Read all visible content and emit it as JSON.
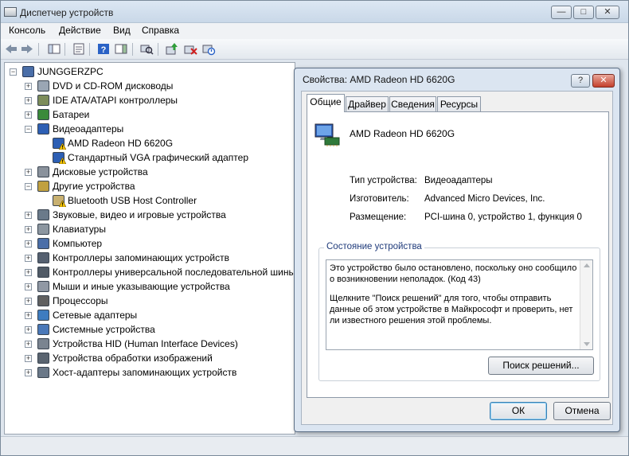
{
  "window": {
    "title": "Диспетчер устройств",
    "caption": {
      "minimize": "—",
      "maximize": "□",
      "close": "✕"
    }
  },
  "menu": [
    "Консоль",
    "Действие",
    "Вид",
    "Справка"
  ],
  "tree": {
    "root": "JUNGGERZPC",
    "items": [
      {
        "label": "DVD и CD-ROM дисководы",
        "icon": "dvd-drive-icon"
      },
      {
        "label": "IDE ATA/ATAPI контроллеры",
        "icon": "ide-controller-icon"
      },
      {
        "label": "Батареи",
        "icon": "battery-icon"
      },
      {
        "label": "Видеоадаптеры",
        "icon": "display-adapter-icon",
        "expanded": true,
        "children": [
          {
            "label": "AMD Radeon HD 6620G",
            "icon": "display-adapter-icon",
            "warning": true
          },
          {
            "label": "Стандартный VGA графический адаптер",
            "icon": "display-adapter-icon",
            "warning": true
          }
        ]
      },
      {
        "label": "Дисковые устройства",
        "icon": "disk-drive-icon"
      },
      {
        "label": "Другие устройства",
        "icon": "other-devices-icon",
        "expanded": true,
        "children": [
          {
            "label": "Bluetooth USB Host Controller",
            "icon": "unknown-device-icon",
            "warning": true
          }
        ]
      },
      {
        "label": "Звуковые, видео и игровые устройства",
        "icon": "speaker-icon"
      },
      {
        "label": "Клавиатуры",
        "icon": "keyboard-icon"
      },
      {
        "label": "Компьютер",
        "icon": "computer-icon"
      },
      {
        "label": "Контроллеры запоминающих устройств",
        "icon": "storage-controller-icon"
      },
      {
        "label": "Контроллеры универсальной последовательной шины USB",
        "icon": "usb-icon"
      },
      {
        "label": "Мыши и иные указывающие устройства",
        "icon": "mouse-icon"
      },
      {
        "label": "Процессоры",
        "icon": "processor-icon"
      },
      {
        "label": "Сетевые адаптеры",
        "icon": "network-adapter-icon"
      },
      {
        "label": "Системные устройства",
        "icon": "system-device-icon"
      },
      {
        "label": "Устройства HID (Human Interface Devices)",
        "icon": "hid-icon"
      },
      {
        "label": "Устройства обработки изображений",
        "icon": "imaging-device-icon"
      },
      {
        "label": "Хост-адаптеры запоминающих устройств",
        "icon": "storage-host-adapter-icon"
      }
    ]
  },
  "dialog": {
    "title": "Свойства: AMD Radeon HD 6620G",
    "caption": {
      "help": "?",
      "close": "✕"
    },
    "tabs": [
      "Общие",
      "Драйвер",
      "Сведения",
      "Ресурсы"
    ],
    "device_name": "AMD Radeon HD 6620G",
    "properties": [
      {
        "label": "Тип устройства:",
        "value": "Видеоадаптеры"
      },
      {
        "label": "Изготовитель:",
        "value": "Advanced Micro Devices, Inc."
      },
      {
        "label": "Размещение:",
        "value": "PCI-шина 0, устройство 1, функция 0"
      }
    ],
    "status_group": "Состояние устройства",
    "status_text_1": "Это устройство было остановлено, поскольку оно сообщило\nо возникновении неполадок. (Код 43)",
    "status_text_2": "Щелкните \"Поиск решений\" для того, чтобы отправить\nданные об этом устройстве в Майкрософт и проверить, нет\nли известного решения этой проблемы.",
    "find_solutions": "Поиск решений...",
    "ok": "ОК",
    "cancel": "Отмена"
  },
  "colors": {
    "warning": "#f2c200",
    "accent": "#3c7fb1"
  }
}
